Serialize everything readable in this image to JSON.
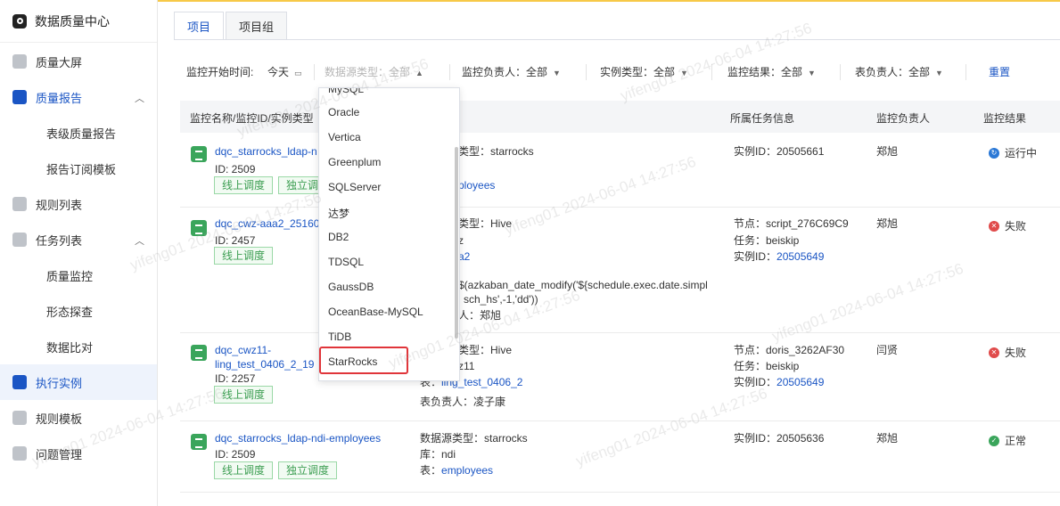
{
  "app": {
    "title": "数据质量中心"
  },
  "sidebar": {
    "items": [
      {
        "label": "质量大屏"
      },
      {
        "label": "质量报告"
      },
      {
        "label": "表级质量报告"
      },
      {
        "label": "报告订阅模板"
      },
      {
        "label": "规则列表"
      },
      {
        "label": "任务列表"
      },
      {
        "label": "质量监控"
      },
      {
        "label": "形态探查"
      },
      {
        "label": "数据比对"
      },
      {
        "label": "执行实例"
      },
      {
        "label": "规则模板"
      },
      {
        "label": "问题管理"
      }
    ]
  },
  "tabs": [
    "项目",
    "项目组"
  ],
  "filters": {
    "start_time_label": "监控开始时间:",
    "start_time_value": "今天",
    "datasource_type": "数据源类型：全部",
    "monitor_owner": "监控负责人：全部",
    "instance_type": "实例类型：全部",
    "monitor_result": "监控结果：全部",
    "table_owner": "表负责人：全部",
    "reset": "重置"
  },
  "table": {
    "headers": [
      "监控名称/监控ID/实例类型",
      "所属任务信息",
      "监控负责人",
      "监控结果"
    ],
    "rows": [
      {
        "name": "dqc_starrocks_ldap-n",
        "id": "ID: 2509",
        "tags": [
          "线上调度",
          "独立调"
        ],
        "obj_lines": [
          "类型：starrocks",
          "",
          "ployees"
        ],
        "task_lines": [
          "实例ID：20505661"
        ],
        "owner": "郑旭",
        "result": "运行中"
      },
      {
        "name": "dqc_cwz-aaa2_25160",
        "id": "ID: 2457",
        "tags": [
          "线上调度"
        ],
        "obj_lines": [
          "类型：Hive",
          "z",
          "a2",
          "",
          "$(azkaban_date_modify('${schedule.exec.date.simpl",
          "sch_hs',-1,'dd'))",
          "人：郑旭"
        ],
        "task_node": "节点：script_276C69C9",
        "task_task": "任务：beiskip",
        "task_inst_label": "实例ID：",
        "task_inst": "20505649",
        "owner": "郑旭",
        "result": "失败"
      },
      {
        "name": "dqc_cwz11-",
        "name2": "ling_test_0406_2_19",
        "id": "ID: 2257",
        "tags": [
          "线上调度"
        ],
        "obj_lines": [
          "类型：Hive",
          "z11"
        ],
        "obj_table_label": "表：",
        "obj_table": "ling_test_0406_2",
        "obj_owner": "表负责人：凌子康",
        "task_node": "节点：doris_3262AF30",
        "task_task": "任务：beiskip",
        "task_inst_label": "实例ID：",
        "task_inst": "20505649",
        "owner": "闫贤",
        "result": "失败"
      },
      {
        "name": "dqc_starrocks_ldap-ndi-employees",
        "id": "ID: 2509",
        "tags": [
          "线上调度",
          "独立调度"
        ],
        "obj_type": "数据源类型：starrocks",
        "obj_db": "库：ndi",
        "obj_table_label": "表：",
        "obj_table": "employees",
        "task_lines": [
          "实例ID：20505636"
        ],
        "owner": "郑旭",
        "result": "正常"
      }
    ]
  },
  "dropdown": {
    "items": [
      "MySQL",
      "Oracle",
      "Vertica",
      "Greenplum",
      "SQLServer",
      "达梦",
      "DB2",
      "TDSQL",
      "GaussDB",
      "OceanBase-MySQL",
      "TiDB",
      "StarRocks"
    ],
    "highlighted": "StarRocks"
  },
  "watermark": "yifeng01 2024-06-04 14:27:56",
  "colors": {
    "accent": "#1a55c4",
    "success": "#3aa55b",
    "danger": "#e04b4b",
    "highlight": "#e0353a"
  }
}
